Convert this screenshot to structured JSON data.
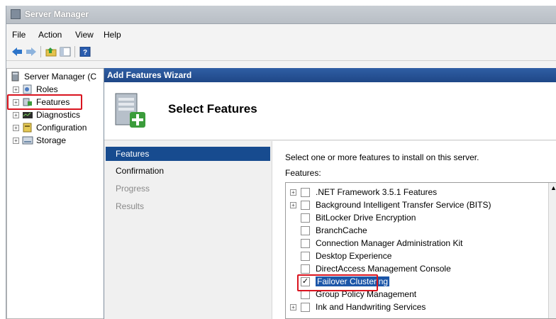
{
  "window": {
    "title": "Server Manager"
  },
  "menu": {
    "file": "File",
    "action": "Action",
    "view": "View",
    "help": "Help"
  },
  "toolbar": {
    "icons": [
      "back-arrow-icon",
      "forward-arrow-icon",
      "up-folder-icon",
      "show-hide-console-tree-icon",
      "help-icon"
    ]
  },
  "tree": {
    "root": "Server Manager (C",
    "items": [
      {
        "label": "Roles"
      },
      {
        "label": "Features"
      },
      {
        "label": "Diagnostics"
      },
      {
        "label": "Configuration"
      },
      {
        "label": "Storage"
      }
    ]
  },
  "wizard": {
    "title": "Add Features Wizard",
    "heading": "Select Features",
    "steps": [
      {
        "label": "Features",
        "state": "active"
      },
      {
        "label": "Confirmation",
        "state": "done"
      },
      {
        "label": "Progress",
        "state": "pending"
      },
      {
        "label": "Results",
        "state": "pending"
      }
    ],
    "instruction": "Select one or more features to install on this server.",
    "features_label": "Features:",
    "features": [
      {
        "label": ".NET Framework 3.5.1 Features",
        "expandable": true,
        "checked": false
      },
      {
        "label": "Background Intelligent Transfer Service (BITS)",
        "expandable": true,
        "checked": false
      },
      {
        "label": "BitLocker Drive Encryption",
        "expandable": false,
        "checked": false
      },
      {
        "label": "BranchCache",
        "expandable": false,
        "checked": false
      },
      {
        "label": "Connection Manager Administration Kit",
        "expandable": false,
        "checked": false
      },
      {
        "label": "Desktop Experience",
        "expandable": false,
        "checked": false
      },
      {
        "label": "DirectAccess Management Console",
        "expandable": false,
        "checked": false
      },
      {
        "label": "Failover Clustering",
        "expandable": false,
        "checked": true,
        "selected": true
      },
      {
        "label": "Group Policy Management",
        "expandable": false,
        "checked": false
      },
      {
        "label": "Ink and Handwriting Services",
        "expandable": true,
        "checked": false
      }
    ]
  },
  "colors": {
    "highlight_box": "#d9141f",
    "selection": "#1c56a8",
    "wizard_title": "#2f5ea4"
  }
}
